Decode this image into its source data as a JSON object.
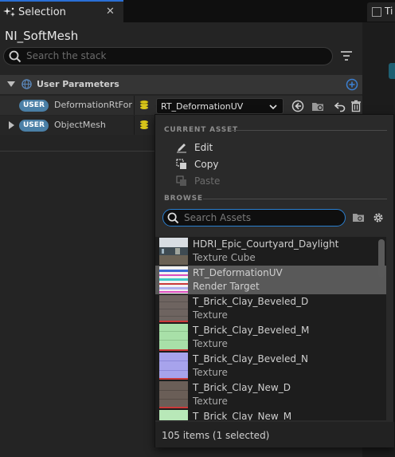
{
  "tab": {
    "title": "Selection",
    "close": "✕",
    "right_label": "Ti"
  },
  "system_name": "NI_SoftMesh",
  "stack_search": {
    "placeholder": "Search the stack"
  },
  "section": {
    "label": "User Parameters"
  },
  "params": [
    {
      "badge": "USER",
      "name": "DeformationRtForU",
      "value": "RT_DeformationUV"
    },
    {
      "badge": "USER",
      "name": "ObjectMesh"
    }
  ],
  "popup": {
    "current_asset_header": "CURRENT ASSET",
    "menu": {
      "edit": "Edit",
      "copy": "Copy",
      "paste": "Paste"
    },
    "browse_header": "BROWSE",
    "search_placeholder": "Search Assets",
    "assets": [
      {
        "name": "HDRI_Epic_Courtyard_Daylight",
        "type": "Texture Cube",
        "selected": false
      },
      {
        "name": "RT_DeformationUV",
        "type": "Render Target",
        "selected": true
      },
      {
        "name": "T_Brick_Clay_Beveled_D",
        "type": "Texture",
        "selected": false
      },
      {
        "name": "T_Brick_Clay_Beveled_M",
        "type": "Texture",
        "selected": false
      },
      {
        "name": "T_Brick_Clay_Beveled_N",
        "type": "Texture",
        "selected": false
      },
      {
        "name": "T_Brick_Clay_New_D",
        "type": "Texture",
        "selected": false
      },
      {
        "name": "T_Brick_Clay_New_M",
        "type": "",
        "selected": false
      }
    ],
    "footer": "105 items (1 selected)"
  },
  "colors": {
    "accent": "#2a7fd0",
    "user_badge": "#4a7fa6",
    "coins": "#d8c61a",
    "selected_row": "#595959"
  }
}
